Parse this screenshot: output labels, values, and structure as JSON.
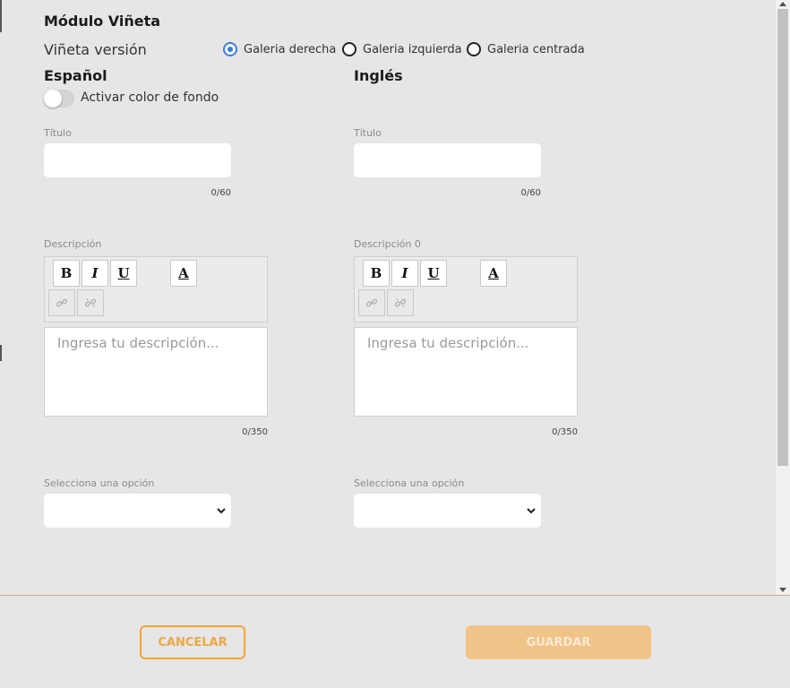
{
  "module": {
    "title": "Módulo Viñeta",
    "version_label": "Viñeta versión",
    "version_options": [
      {
        "label": "Galeria derecha",
        "selected": true
      },
      {
        "label": "Galeria izquierda",
        "selected": false
      },
      {
        "label": "Galeria centrada",
        "selected": false
      }
    ]
  },
  "spanish": {
    "heading": "Español",
    "toggle_label": "Activar color de fondo",
    "title_label": "Título",
    "title_value": "",
    "title_counter": "0/60",
    "desc_label": "Descripción",
    "desc_placeholder": "Ingresa tu descripción...",
    "desc_counter": "0/350",
    "select_label": "Selecciona una opción",
    "select_value": ""
  },
  "english": {
    "heading": "Inglés",
    "title_label": "Título",
    "title_value": "",
    "title_counter": "0/60",
    "desc_label": "Descripción 0",
    "desc_placeholder": "Ingresa tu descripción...",
    "desc_counter": "0/350",
    "select_label": "Selecciona una opción",
    "select_value": ""
  },
  "toolbar": {
    "bold": "B",
    "italic": "I",
    "underline": "U",
    "font_color": "A",
    "link_icon": "link-icon",
    "unlink_icon": "unlink-icon"
  },
  "footer": {
    "cancel_label": "CANCELAR",
    "save_label": "GUARDAR"
  },
  "colors": {
    "accent": "#f0a640",
    "save_disabled": "#efc489",
    "radio_selected": "#3b7be0",
    "background": "#e6e6e6"
  }
}
